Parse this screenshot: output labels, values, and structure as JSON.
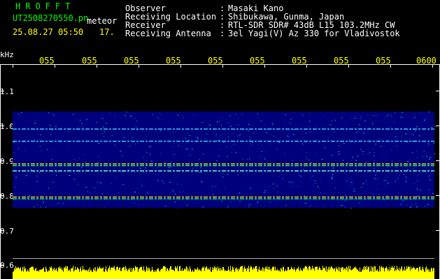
{
  "header": {
    "title": "HROFFT",
    "filename": "UT2508270550.pn",
    "meteor_label": "meteor",
    "datetime": "25.08.27 05:50",
    "count": "17."
  },
  "info": [
    {
      "label": "Observer",
      "value": "Masaki Kano"
    },
    {
      "label": "Receiving Location",
      "value": "Shibukawa, Gunma, Japan"
    },
    {
      "label": "Receiver",
      "value": "RTL-SDR SDR# 43dB L15 103.2MHz CW"
    },
    {
      "label": "Receiving Antenna",
      "value": "3el Yagi(V) Az 330 for Vladivostok"
    }
  ],
  "axis": {
    "y_unit": "kHz",
    "y_ticks": [
      "1.1",
      "1.0",
      "0.9",
      "0.8",
      "0.7",
      "0.6"
    ],
    "x_ticks": [
      "055",
      "055",
      "055",
      "055",
      "055",
      "055",
      "055",
      "055",
      "055",
      "0600"
    ]
  },
  "chart_data": {
    "type": "heatmap",
    "ylabel": "kHz",
    "ylim": [
      0.6,
      1.15
    ],
    "x_tick_labels": [
      "055",
      "055",
      "055",
      "055",
      "055",
      "055",
      "055",
      "055",
      "055",
      "0600"
    ],
    "signal_lines_khz": [
      0.99,
      0.955,
      0.89,
      0.885,
      0.87,
      0.795,
      0.79
    ],
    "colors": {
      "background": "#000000",
      "noise": "#00008b",
      "text_green": "#00ff00",
      "text_yellow": "#ffff00"
    }
  }
}
